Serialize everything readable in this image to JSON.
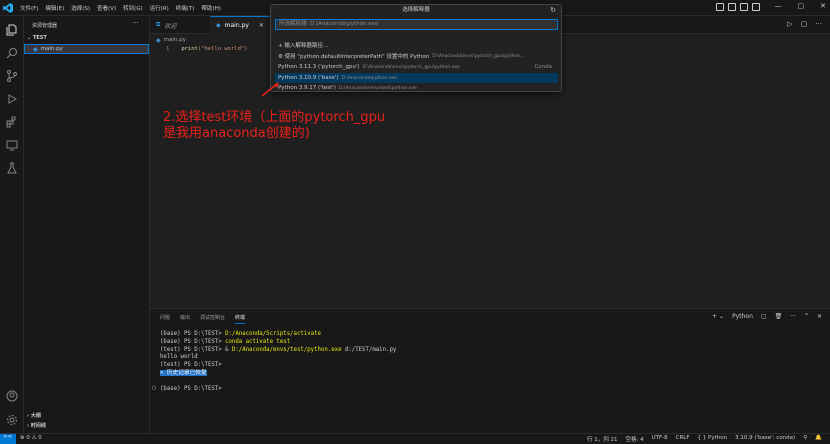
{
  "menu": [
    "文件(F)",
    "编辑(E)",
    "选择(S)",
    "查看(V)",
    "转到(G)",
    "运行(R)",
    "终端(T)",
    "帮助(H)"
  ],
  "window_controls": [
    "—",
    "▢",
    "✕"
  ],
  "sidebar": {
    "header": "资源管理器",
    "more": "···",
    "folder": "TEST",
    "file": "main.py",
    "outline": "大纲",
    "timeline": "时间线"
  },
  "tabs": [
    {
      "label": "欢迎",
      "icon": "vscode-icon"
    },
    {
      "label": "main.py",
      "icon": "python-file-icon",
      "active": true
    }
  ],
  "tab_close": "✕",
  "tab_actions": [
    "▷",
    "▢",
    "···"
  ],
  "breadcrumb": [
    "main.py"
  ],
  "code": {
    "line_no": "1",
    "fn": "print",
    "text": "(\"hello world\")"
  },
  "picker": {
    "title": "选择解释器",
    "refresh": "↻",
    "placeholder": "所选解释器: D:\\Anaconda\\python.exe",
    "rows": [
      {
        "label": "+ 输入解释器路径...",
        "path": ""
      },
      {
        "label": "⚙ 使用 \"python.defaultInterpreterPath\" 设置中的 Python",
        "path": "D:\\Anaconda\\envs\\pytorch_gpu\\python..."
      },
      {
        "label": "Python 3.11.3 ('pytorch_gpu')",
        "path": "D:\\Anaconda\\envs\\pytorch_gpu\\python.exe",
        "tag": "Conda"
      },
      {
        "label": "Python 3.10.9 ('base')",
        "path": "D:\\Anaconda\\python.exe",
        "selected": true
      },
      {
        "label": "Python 3.9.17 ('test')",
        "path": "D:\\Anaconda\\envs\\test\\python.exe"
      }
    ]
  },
  "annotation": {
    "line1": "2.选择test环境（上面的pytorch_gpu",
    "line2": "是我用anaconda创建的)",
    "color": "#e8211b"
  },
  "panel": {
    "tabs": [
      "问题",
      "输出",
      "调试控制台",
      "终端"
    ],
    "actions": [
      "+ ⌄",
      "Python",
      "▢",
      "🗑",
      "···",
      "^",
      "✕"
    ]
  },
  "terminal": {
    "line1": {
      "prefix": "(base) PS D:\\TEST> ",
      "cmd": "D:/Anaconda/Scripts/activate"
    },
    "line2": {
      "prefix": "(base) PS D:\\TEST> ",
      "cmd": "conda activate test"
    },
    "line3": {
      "prefix": "(test) PS D:\\TEST> & ",
      "cmd": "D:/Anaconda/envs/test/python.exe",
      "rest": " d:/TEST/main.py"
    },
    "line4": "hello world",
    "line5": "(test) PS D:\\TEST>",
    "line6_highlight": "✕ 历史记录已恢复",
    "line7": "(base) PS D:\\TEST>"
  },
  "status": {
    "remote": "><",
    "problems": "⊗ 0 ⚠ 0",
    "position": "行 1，列 21",
    "spaces": "空格: 4",
    "encoding": "UTF-8",
    "eol": "CRLF",
    "language": "{ } Python",
    "interpreter": "3.10.9 ('base': conda)"
  }
}
